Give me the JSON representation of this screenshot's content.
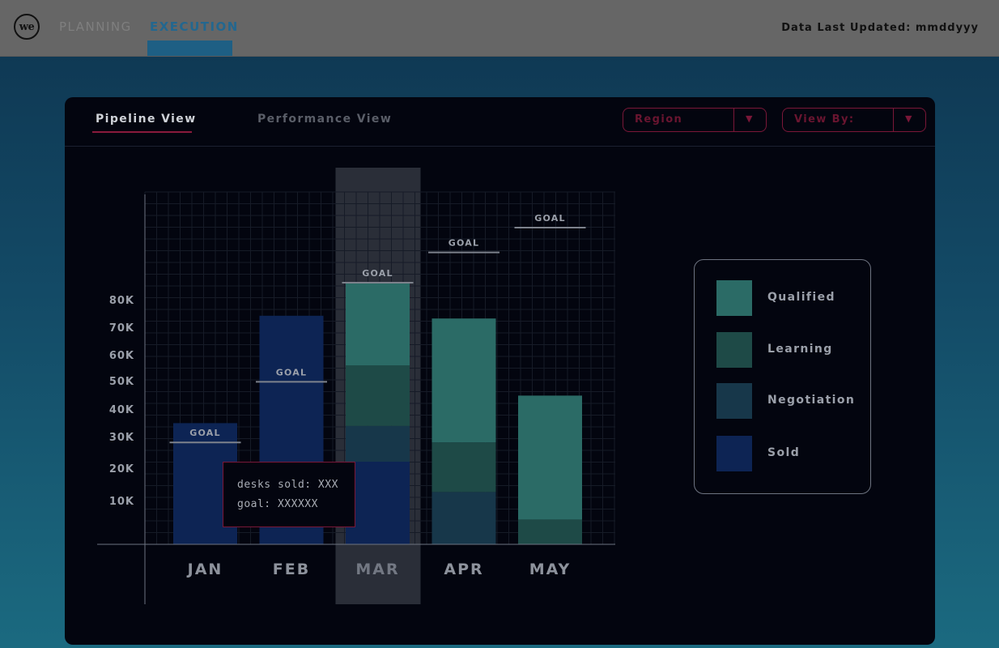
{
  "logo": {
    "text": "we"
  },
  "nav": {
    "tabs": [
      {
        "label": "PLANNING"
      },
      {
        "label": "EXECUTION"
      }
    ],
    "updated": "Data Last Updated: mmddyyy"
  },
  "panel": {
    "tabs": [
      {
        "label": "Pipeline View"
      },
      {
        "label": "Performance View"
      }
    ],
    "region_select": {
      "label": "Region"
    },
    "viewby_select": {
      "label": "View By:"
    }
  },
  "tooltip": {
    "line1": "desks sold: XXX",
    "line2": "goal: XXXXXX"
  },
  "colors": {
    "Qualified": "#2b6b66",
    "Learning": "#1e4a47",
    "Negotiation": "#17374a",
    "Sold": "#0d2454"
  },
  "chart_data": {
    "type": "bar",
    "stacked": true,
    "categories": [
      "JAN",
      "FEB",
      "MAR",
      "APR",
      "MAY"
    ],
    "highlighted_category": "MAR",
    "y_ticks": [
      10000,
      20000,
      30000,
      40000,
      50000,
      60000,
      70000,
      80000
    ],
    "y_tick_labels": [
      "10K",
      "20K",
      "30K",
      "40K",
      "50K",
      "60K",
      "70K",
      "80K"
    ],
    "ylim": [
      0,
      110000
    ],
    "series": [
      {
        "name": "Sold",
        "values": [
          44000,
          83000,
          30000,
          0,
          0
        ]
      },
      {
        "name": "Negotiation",
        "values": [
          0,
          0,
          13000,
          19000,
          0
        ]
      },
      {
        "name": "Learning",
        "values": [
          0,
          0,
          22000,
          18000,
          9000
        ]
      },
      {
        "name": "Qualified",
        "values": [
          0,
          0,
          30000,
          45000,
          45000
        ]
      }
    ],
    "goal_label": "GOAL",
    "goals": [
      37000,
      59000,
      95000,
      106000,
      115000
    ],
    "legend": [
      "Qualified",
      "Learning",
      "Negotiation",
      "Sold"
    ],
    "legend_position": "right",
    "grid": true
  }
}
